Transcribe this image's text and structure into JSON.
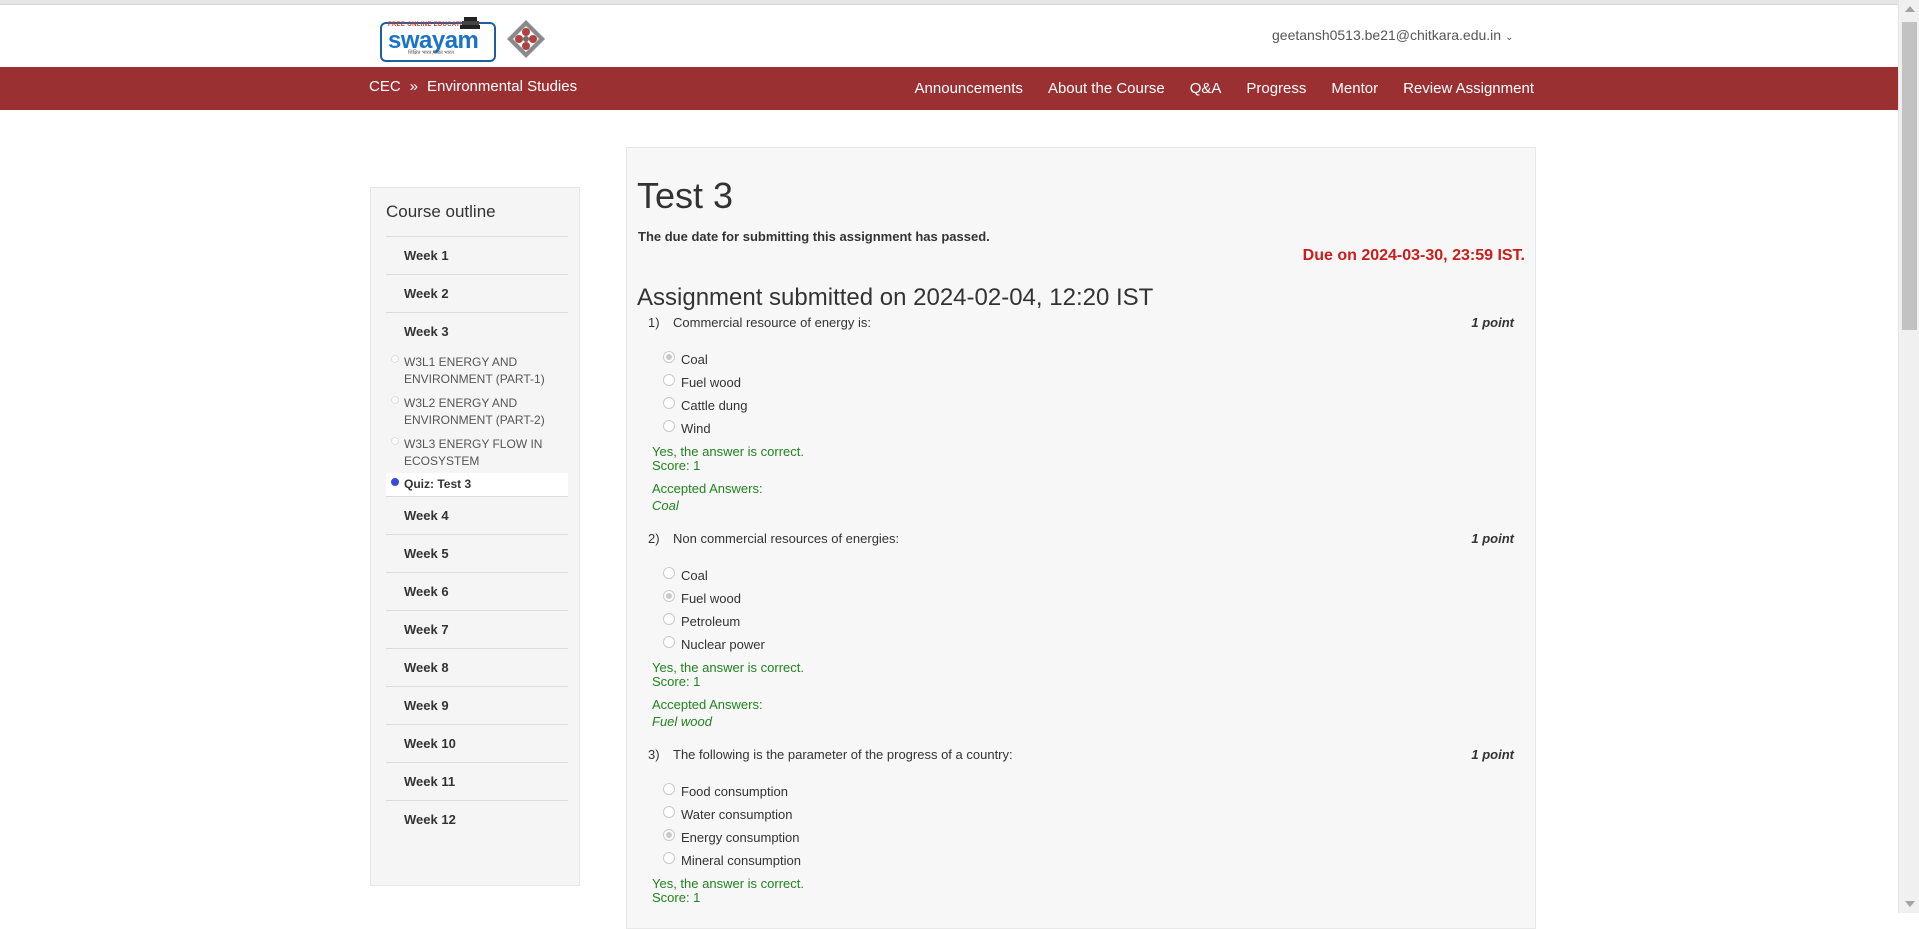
{
  "header": {
    "logo": {
      "tagline": "FREE ONLINE EDUCATION",
      "word": "swayam",
      "sub": "शिक्षित भारत, उन्नत भारत"
    },
    "user_email": "geetansh0513.be21@chitkara.edu.in"
  },
  "navbar": {
    "breadcrumb": {
      "root": "CEC",
      "separator": "»",
      "course": "Environmental Studies"
    },
    "links": [
      "Announcements",
      "About the Course",
      "Q&A",
      "Progress",
      "Mentor",
      "Review Assignment"
    ],
    "color": "#9b3033"
  },
  "sidebar": {
    "title": "Course outline",
    "weeks_before": [
      "Week 1",
      "Week 2",
      "Week 3"
    ],
    "units": [
      {
        "label": "W3L1 ENERGY AND ENVIRONMENT (PART-1)",
        "active": false
      },
      {
        "label": "W3L2 ENERGY AND ENVIRONMENT (PART-2)",
        "active": false
      },
      {
        "label": "W3L3 ENERGY FLOW IN ECOSYSTEM",
        "active": false
      },
      {
        "label": "Quiz: Test 3",
        "active": true
      }
    ],
    "weeks_after": [
      "Week 4",
      "Week 5",
      "Week 6",
      "Week 7",
      "Week 8",
      "Week 9",
      "Week 10",
      "Week 11",
      "Week 12"
    ]
  },
  "assignment": {
    "title": "Test 3",
    "due_passed": "The due date for submitting this assignment has passed.",
    "due_on": "Due on 2024-03-30, 23:59 IST.",
    "submitted": "Assignment submitted on 2024-02-04, 12:20 IST",
    "questions": [
      {
        "num": "1)",
        "text": "Commercial resource of energy is:",
        "points": "1 point",
        "options": [
          "Coal",
          "Fuel wood",
          "Cattle dung",
          "Wind"
        ],
        "selected": 0,
        "feedback": "Yes, the answer is correct.",
        "score": "Score: 1",
        "accepted_label": "Accepted Answers:",
        "accepted": "Coal"
      },
      {
        "num": "2)",
        "text": "Non commercial resources of energies:",
        "points": "1 point",
        "options": [
          "Coal",
          "Fuel wood",
          "Petroleum",
          "Nuclear power"
        ],
        "selected": 1,
        "feedback": "Yes, the answer is correct.",
        "score": "Score: 1",
        "accepted_label": "Accepted Answers:",
        "accepted": "Fuel wood"
      },
      {
        "num": "3)",
        "text": "The following is the parameter of the progress of a country:",
        "points": "1 point",
        "options": [
          "Food consumption",
          "Water consumption",
          "Energy consumption",
          "Mineral consumption"
        ],
        "selected": 2,
        "feedback": "Yes, the answer is correct.",
        "score": "Score: 1"
      }
    ]
  }
}
